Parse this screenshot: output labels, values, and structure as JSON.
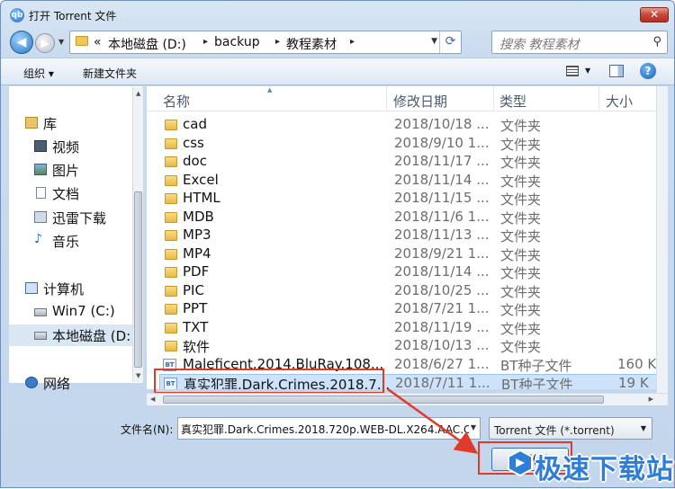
{
  "title": "打开 Torrent 文件",
  "title_icon": "qb",
  "close_glyph": "✕",
  "address": {
    "root": "«",
    "parts": [
      "本地磁盘 (D:)",
      "backup",
      "教程素材"
    ]
  },
  "search": {
    "placeholder": "搜索 教程素材"
  },
  "toolbar": {
    "organize": "组织 ▾",
    "new_folder": "新建文件夹"
  },
  "nav": {
    "items": [
      {
        "label": "库",
        "icon": "library-icon"
      },
      {
        "label": "视频",
        "icon": "video-icon"
      },
      {
        "label": "图片",
        "icon": "picture-icon"
      },
      {
        "label": "文档",
        "icon": "document-icon"
      },
      {
        "label": "迅雷下载",
        "icon": "download-folder-icon"
      },
      {
        "label": "音乐",
        "icon": "music-icon"
      },
      {
        "label": "计算机",
        "icon": "computer-icon"
      },
      {
        "label": "Win7 (C:)",
        "icon": "drive-icon"
      },
      {
        "label": "本地磁盘 (D:",
        "icon": "drive-icon"
      },
      {
        "label": "网络",
        "icon": "network-icon"
      }
    ]
  },
  "columns": {
    "name": "名称",
    "date": "修改日期",
    "type": "类型",
    "size": "大小"
  },
  "files": [
    {
      "name": "cad",
      "date": "2018/10/18 ...",
      "type": "文件夹",
      "size": "",
      "kind": "folder"
    },
    {
      "name": "css",
      "date": "2018/9/10 1...",
      "type": "文件夹",
      "size": "",
      "kind": "folder"
    },
    {
      "name": "doc",
      "date": "2018/11/17 ...",
      "type": "文件夹",
      "size": "",
      "kind": "folder"
    },
    {
      "name": "Excel",
      "date": "2018/11/14 ...",
      "type": "文件夹",
      "size": "",
      "kind": "folder"
    },
    {
      "name": "HTML",
      "date": "2018/11/15 ...",
      "type": "文件夹",
      "size": "",
      "kind": "folder"
    },
    {
      "name": "MDB",
      "date": "2018/11/6 1...",
      "type": "文件夹",
      "size": "",
      "kind": "folder"
    },
    {
      "name": "MP3",
      "date": "2018/11/13 ...",
      "type": "文件夹",
      "size": "",
      "kind": "folder"
    },
    {
      "name": "MP4",
      "date": "2018/9/21 1...",
      "type": "文件夹",
      "size": "",
      "kind": "folder"
    },
    {
      "name": "PDF",
      "date": "2018/11/14 ...",
      "type": "文件夹",
      "size": "",
      "kind": "folder"
    },
    {
      "name": "PIC",
      "date": "2018/10/25 ...",
      "type": "文件夹",
      "size": "",
      "kind": "folder"
    },
    {
      "name": "PPT",
      "date": "2018/7/21 1...",
      "type": "文件夹",
      "size": "",
      "kind": "folder"
    },
    {
      "name": "TXT",
      "date": "2018/11/19 ...",
      "type": "文件夹",
      "size": "",
      "kind": "folder"
    },
    {
      "name": "软件",
      "date": "2018/10/13 ...",
      "type": "文件夹",
      "size": "",
      "kind": "folder"
    },
    {
      "name": "Maleficent.2014.BluRay.108...",
      "date": "2018/6/27 1...",
      "type": "BT种子文件",
      "size": "160 K",
      "kind": "torrent"
    },
    {
      "name": "真实犯罪.Dark.Crimes.2018.7...",
      "date": "2018/7/11 1...",
      "type": "BT种子文件",
      "size": "19 K",
      "kind": "torrent"
    }
  ],
  "filename": {
    "label": "文件名(N):",
    "value": "真实犯罪.Dark.Crimes.2018.720p.WEB-DL.X264.AAC.CHS"
  },
  "filetype": {
    "value": "Torrent 文件 (*.torrent)"
  },
  "open_button": "打开(O)",
  "watermark": "极速下载站",
  "colors": {
    "highlight_red": "#e03a2a",
    "selection": "#cce3fb",
    "accent": "#2e7dd6"
  }
}
